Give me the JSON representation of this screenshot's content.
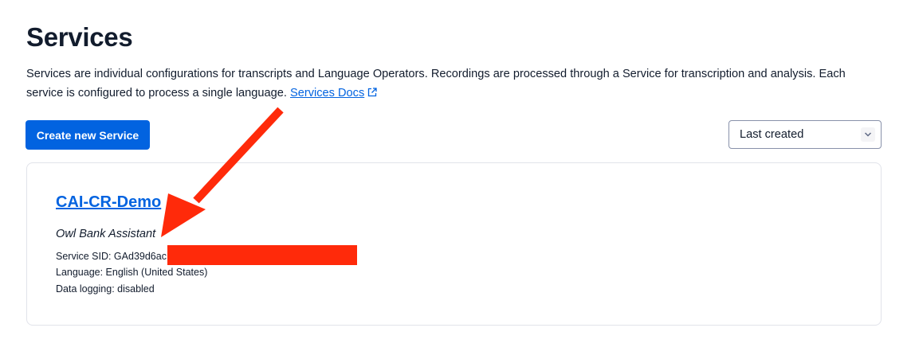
{
  "page": {
    "title": "Services",
    "description": "Services are individual configurations for transcripts and Language Operators. Recordings are processed through a Service for transcription and analysis. Each service is configured to process a single language. ",
    "docs_link": "Services Docs",
    "create_button": "Create new Service",
    "sort": {
      "selected": "Last created"
    }
  },
  "service": {
    "name": "CAI-CR-Demo",
    "friendly_name": "Owl Bank Assistant",
    "sid": "Service SID: GAd39d6ac",
    "language": "Language: English (United States)",
    "data_logging": "Data logging: disabled"
  },
  "annotations": {
    "arrow_color": "#ff2a0a",
    "redaction_color": "#ff2a0a"
  },
  "colors": {
    "link": "#0263e0",
    "primary_button": "#0263e0",
    "text": "#121c2d"
  }
}
